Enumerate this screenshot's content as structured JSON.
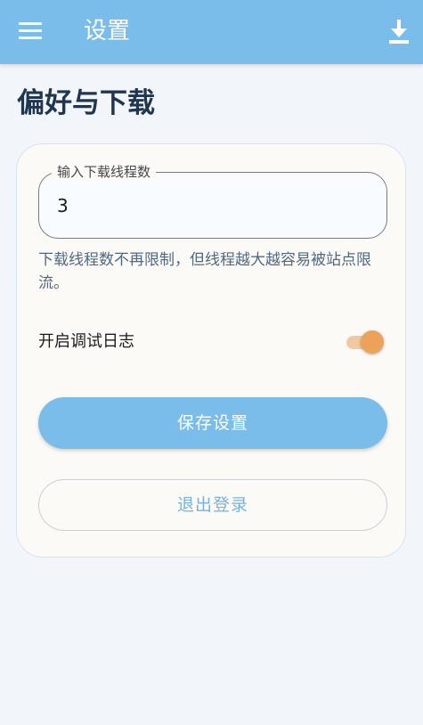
{
  "appbar": {
    "title": "设置",
    "background": "#7bbdea",
    "left_icon": "menu-icon",
    "right_icon": "download-icon"
  },
  "page": {
    "heading": "偏好与下载"
  },
  "thread_field": {
    "label": "输入下载线程数",
    "value": "3"
  },
  "help": {
    "text": "下载线程数不再限制，但线程越大越容易被站点限流。"
  },
  "debug_log": {
    "label": "开启调试日志",
    "enabled": true,
    "accent": "#eda25c"
  },
  "buttons": {
    "save_label": "保存设置",
    "logout_label": "退出登录"
  }
}
